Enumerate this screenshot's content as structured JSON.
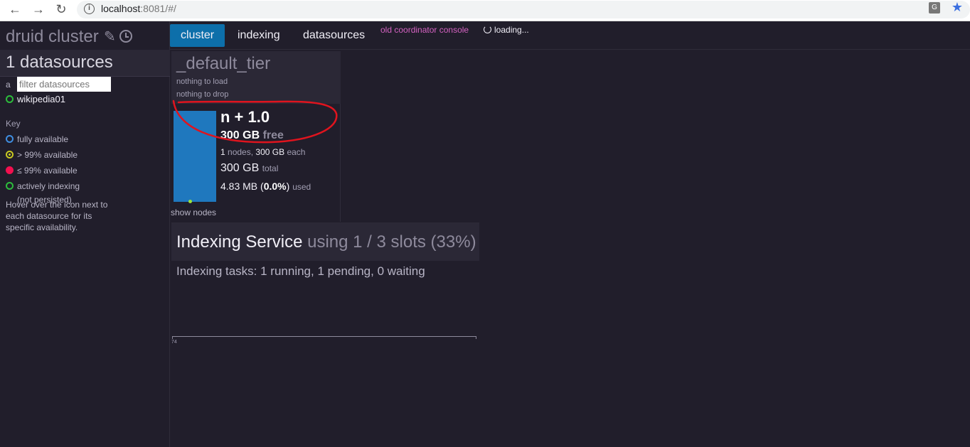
{
  "browser": {
    "url_host": "localhost",
    "url_rest": ":8081/#/"
  },
  "brand": {
    "title": "druid cluster"
  },
  "sidebar": {
    "header": "1 datasources",
    "filter_prefix": "a",
    "filter_placeholder": "filter datasources",
    "datasources": [
      {
        "name": "wikipedia01",
        "status": "actively-indexing"
      }
    ],
    "key_title": "Key",
    "key": [
      {
        "label": "fully available"
      },
      {
        "label": "> 99% available"
      },
      {
        "label": "≤ 99% available"
      },
      {
        "label": "actively indexing",
        "sub": "(not persisted)"
      }
    ],
    "hover_note": "Hover over the icon next to each datasource for its specific availability."
  },
  "nav": {
    "tabs": [
      {
        "label": "cluster"
      },
      {
        "label": "indexing"
      },
      {
        "label": "datasources"
      }
    ],
    "old_console": "old coordinator console",
    "loading": "loading..."
  },
  "tier": {
    "name": "_default_tier",
    "load_note": "nothing to load",
    "drop_note": "nothing to drop",
    "replication": "n + 1.0",
    "free_amount": "300 GB",
    "free_label": "free",
    "node_count": "1",
    "nodes_label": "nodes,",
    "node_size": "300 GB",
    "each_label": "each",
    "total_amount": "300 GB",
    "total_label": "total",
    "used_amount": "4.83 MB",
    "used_pct": "0.0%",
    "used_label": "used",
    "show_nodes": "show nodes"
  },
  "indexing": {
    "title": "Indexing Service",
    "slots": "using 1 / 3 slots (33%)",
    "tasks": "Indexing tasks: 1 running, 1 pending, 0 waiting",
    "axis_tick": "74"
  },
  "colors": {
    "active_tab": "#0d6faa",
    "bar": "#1f78be",
    "old_console": "#d462c1",
    "annotation": "#e0141e"
  }
}
